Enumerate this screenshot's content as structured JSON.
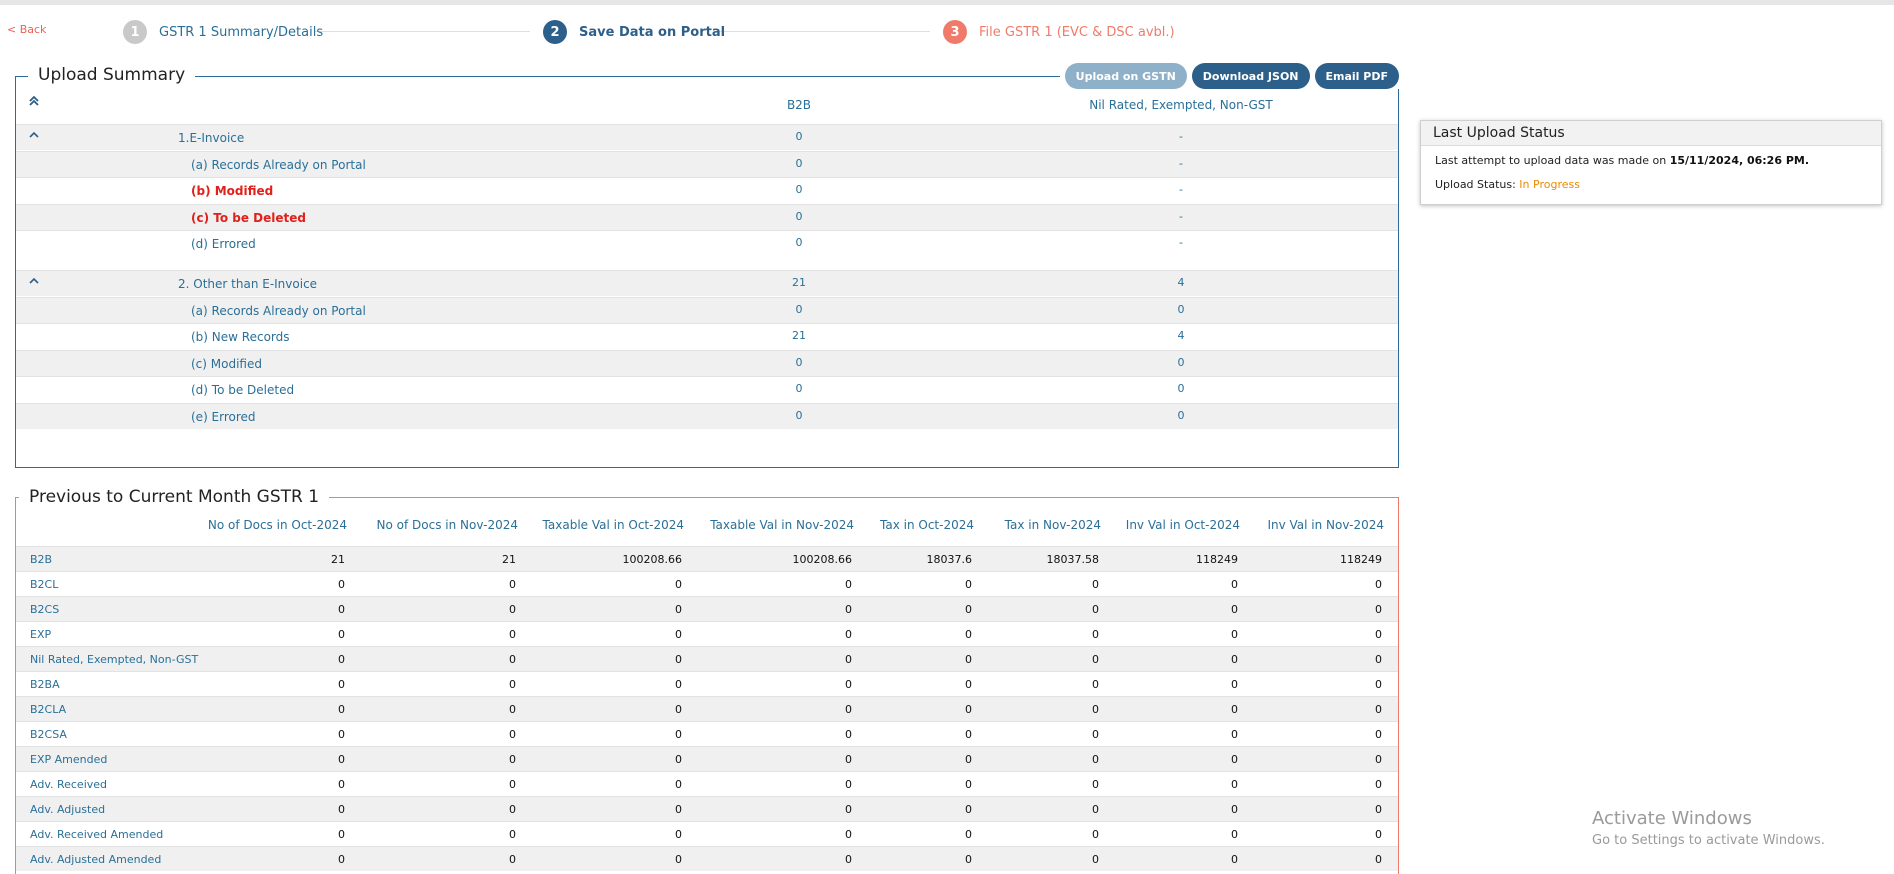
{
  "nav": {
    "back_label": "< Back",
    "steps": [
      {
        "num": "1",
        "label": "GSTR 1 Summary/Details"
      },
      {
        "num": "2",
        "label": "Save Data on Portal"
      },
      {
        "num": "3",
        "label": "File GSTR 1 (EVC & DSC avbl.)"
      }
    ]
  },
  "upload_summary": {
    "title": "Upload Summary",
    "buttons": {
      "upload": "Upload on GSTN",
      "download": "Download JSON",
      "email": "Email PDF"
    },
    "collapse_icon": "double-chevron-up-icon",
    "columns": [
      "B2B",
      "Nil Rated, Exempted, Non-GST"
    ],
    "groups": [
      {
        "label": "1.E-Invoice",
        "b2b": "0",
        "nil": "-",
        "rows": [
          {
            "label": "(a) Records Already on Portal",
            "b2b": "0",
            "nil": "-"
          },
          {
            "label": "(b) Modified",
            "b2b": "0",
            "nil": "-"
          },
          {
            "label": "(c) To be Deleted",
            "b2b": "0",
            "nil": "-"
          },
          {
            "label": "(d) Errored",
            "b2b": "0",
            "nil": "-"
          }
        ]
      },
      {
        "label": "2. Other than E-Invoice",
        "b2b": "21",
        "nil": "4",
        "rows": [
          {
            "label": "(a) Records Already on Portal",
            "b2b": "0",
            "nil": "0"
          },
          {
            "label": "(b) New Records",
            "b2b": "21",
            "nil": "4"
          },
          {
            "label": "(c) Modified",
            "b2b": "0",
            "nil": "0"
          },
          {
            "label": "(d) To be Deleted",
            "b2b": "0",
            "nil": "0"
          },
          {
            "label": "(e) Errored",
            "b2b": "0",
            "nil": "0"
          }
        ]
      }
    ]
  },
  "last_upload": {
    "title": "Last Upload Status",
    "attempt_prefix": "Last attempt to upload data was made on ",
    "attempt_time": "15/11/2024, 06:26 PM.",
    "status_prefix": "Upload Status: ",
    "status_value": "In Progress"
  },
  "previous_month": {
    "title": "Previous to Current Month GSTR 1",
    "headers": [
      "No of Docs in Oct-2024",
      "No of Docs in Nov-2024",
      "Taxable Val in Oct-2024",
      "Taxable Val in Nov-2024",
      "Tax in Oct-2024",
      "Tax in Nov-2024",
      "Inv Val in Oct-2024",
      "Inv Val in Nov-2024"
    ],
    "rows": [
      {
        "label": "B2B",
        "values": [
          "21",
          "21",
          "100208.66",
          "100208.66",
          "18037.6",
          "18037.58",
          "118249",
          "118249"
        ]
      },
      {
        "label": "B2CL",
        "values": [
          "0",
          "0",
          "0",
          "0",
          "0",
          "0",
          "0",
          "0"
        ]
      },
      {
        "label": "B2CS",
        "values": [
          "0",
          "0",
          "0",
          "0",
          "0",
          "0",
          "0",
          "0"
        ]
      },
      {
        "label": "EXP",
        "values": [
          "0",
          "0",
          "0",
          "0",
          "0",
          "0",
          "0",
          "0"
        ]
      },
      {
        "label": "Nil Rated, Exempted, Non-GST",
        "values": [
          "0",
          "0",
          "0",
          "0",
          "0",
          "0",
          "0",
          "0"
        ]
      },
      {
        "label": "B2BA",
        "values": [
          "0",
          "0",
          "0",
          "0",
          "0",
          "0",
          "0",
          "0"
        ]
      },
      {
        "label": "B2CLA",
        "values": [
          "0",
          "0",
          "0",
          "0",
          "0",
          "0",
          "0",
          "0"
        ]
      },
      {
        "label": "B2CSA",
        "values": [
          "0",
          "0",
          "0",
          "0",
          "0",
          "0",
          "0",
          "0"
        ]
      },
      {
        "label": "EXP Amended",
        "values": [
          "0",
          "0",
          "0",
          "0",
          "0",
          "0",
          "0",
          "0"
        ]
      },
      {
        "label": "Adv. Received",
        "values": [
          "0",
          "0",
          "0",
          "0",
          "0",
          "0",
          "0",
          "0"
        ]
      },
      {
        "label": "Adv. Adjusted",
        "values": [
          "0",
          "0",
          "0",
          "0",
          "0",
          "0",
          "0",
          "0"
        ]
      },
      {
        "label": "Adv. Received Amended",
        "values": [
          "0",
          "0",
          "0",
          "0",
          "0",
          "0",
          "0",
          "0"
        ]
      },
      {
        "label": "Adv. Adjusted Amended",
        "values": [
          "0",
          "0",
          "0",
          "0",
          "0",
          "0",
          "0",
          "0"
        ]
      }
    ]
  },
  "watermark": {
    "line1": "Activate Windows",
    "line2": "Go to Settings to activate Windows."
  }
}
